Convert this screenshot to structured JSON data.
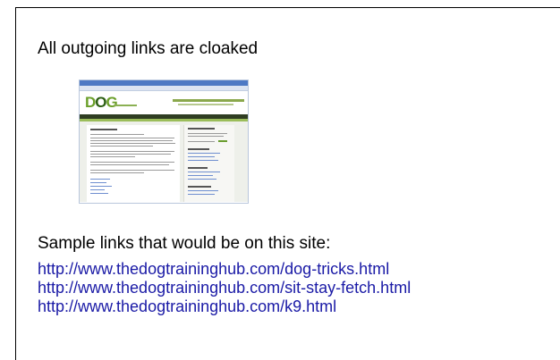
{
  "heading": "All outgoing links are cloaked",
  "thumbnail": {
    "logo_prefix": "D",
    "logo_o": "O",
    "logo_suffix": "G"
  },
  "sample_heading": "Sample links that would be on this site:",
  "links": [
    "http://www.thedogtraininghub.com/dog-tricks.html",
    "http://www.thedogtraininghub.com/sit-stay-fetch.html",
    "http://www.thedogtraininghub.com/k9.html"
  ],
  "colors": {
    "link": "#1a1aa6",
    "text": "#000000",
    "logo_green": "#6b9f2a"
  }
}
